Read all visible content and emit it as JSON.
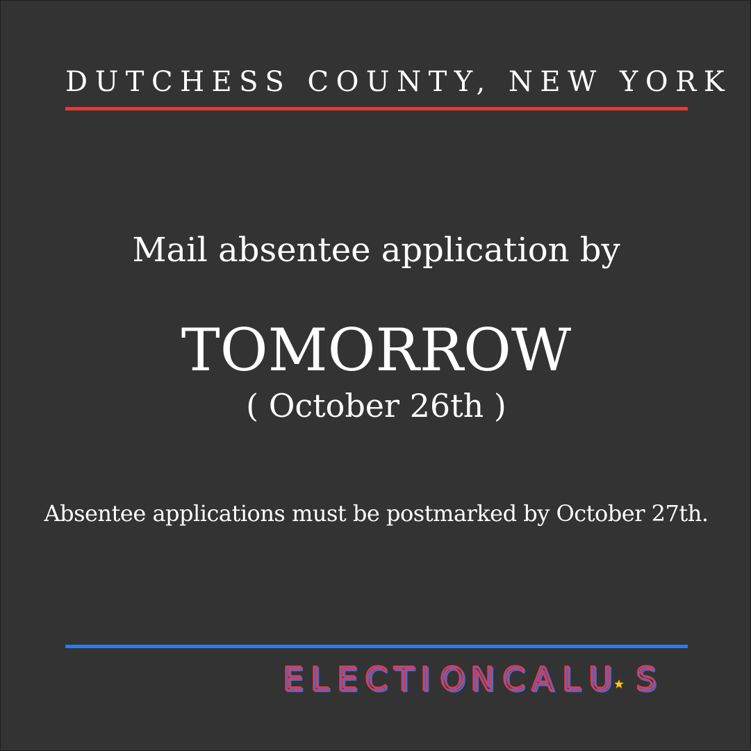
{
  "header": {
    "title": "DUTCHESS COUNTY, NEW YORK"
  },
  "main": {
    "intro": "Mail absentee application by",
    "deadline": "TOMORROW",
    "deadline_date": "( October 26th )",
    "note": "Absentee applications must be postmarked by October 27th."
  },
  "footer": {
    "logo_text": "ELECTIONCAL.US"
  },
  "colors": {
    "background": "#333333",
    "text": "#ffffff",
    "rule_top": "#e53935",
    "rule_bottom": "#2f7ae5",
    "logo_red": "#e53950",
    "logo_blue": "#3f6fd8",
    "star": "#f6c21c"
  }
}
